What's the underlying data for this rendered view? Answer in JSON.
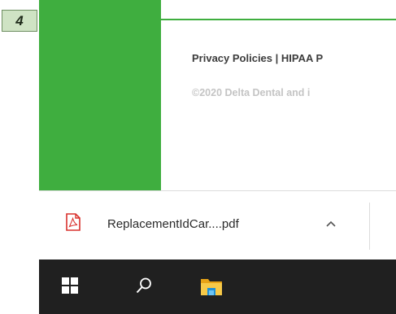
{
  "step": {
    "number": "4"
  },
  "footer": {
    "links": "Privacy Policies | HIPAA P",
    "copyright": "©2020 Delta Dental and i"
  },
  "download_bar": {
    "file_name": "ReplacementIdCar....pdf",
    "file_icon": "pdf-icon",
    "toggle_icon": "chevron-up-icon"
  },
  "taskbar": {
    "icons": [
      "windows-start-icon",
      "search-icon",
      "file-explorer-icon"
    ]
  },
  "colors": {
    "green": "#3fae3f",
    "taskbar": "#202020",
    "pdf_red": "#d9302c"
  }
}
